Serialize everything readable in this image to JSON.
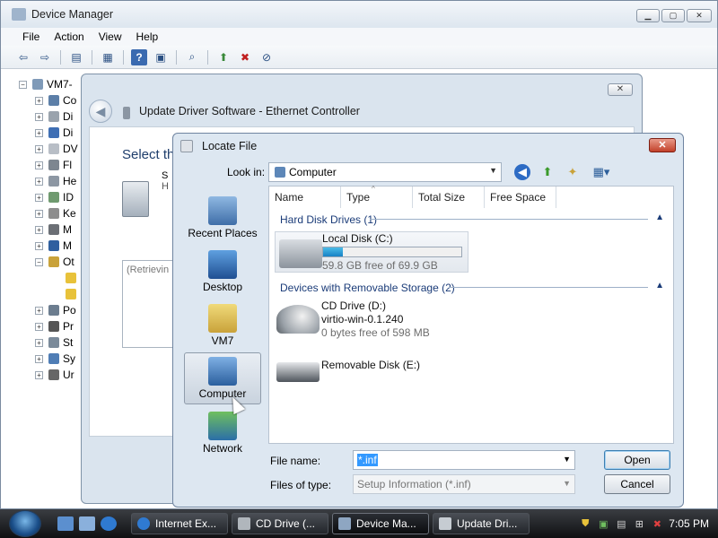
{
  "device_manager": {
    "title": "Device Manager",
    "menu": [
      "File",
      "Action",
      "View",
      "Help"
    ],
    "tree_root": "VM7-",
    "tree_items": [
      "Co",
      "Di",
      "Di",
      "DV",
      "Fl",
      "He",
      "ID",
      "Ke",
      "M",
      "M",
      "Ot",
      "",
      "",
      "Po",
      "Pr",
      "St",
      "Sy",
      "Ur"
    ]
  },
  "update_driver": {
    "title": "Update Driver Software - Ethernet Controller",
    "heading": "Select th",
    "retrieving": "(Retrievin",
    "side_letters": [
      "S",
      "H"
    ]
  },
  "locate_file": {
    "title": "Locate File",
    "look_in_label": "Look in:",
    "look_in_value": "Computer",
    "places": [
      "Recent Places",
      "Desktop",
      "VM7",
      "Computer",
      "Network"
    ],
    "columns": [
      "Name",
      "Type",
      "Total Size",
      "Free Space"
    ],
    "groups": [
      {
        "title": "Hard Disk Drives (1)",
        "drives": [
          {
            "name": "Local Disk (C:)",
            "detail": "59.8 GB free of 69.9 GB",
            "used_fraction": 0.14
          }
        ]
      },
      {
        "title": "Devices with Removable Storage (2)",
        "drives": [
          {
            "name": "CD Drive (D:)",
            "label": "virtio-win-0.1.240",
            "detail": "0 bytes free of 598 MB"
          },
          {
            "name": "Removable Disk (E:)"
          }
        ]
      }
    ],
    "file_name_label": "File name:",
    "file_name_value": "*.inf",
    "files_of_type_label": "Files of type:",
    "files_of_type_value": "Setup Information (*.inf)",
    "open_button": "Open",
    "cancel_button": "Cancel"
  },
  "taskbar": {
    "tasks": [
      "Internet Ex...",
      "CD Drive (...",
      "Device Ma...",
      "Update Dri..."
    ],
    "active_task": 2,
    "clock": "7:05 PM"
  },
  "colors": {
    "accent": "#1a3b78",
    "capacity_bar": "#1782c5",
    "close_red": "#c2412a"
  }
}
